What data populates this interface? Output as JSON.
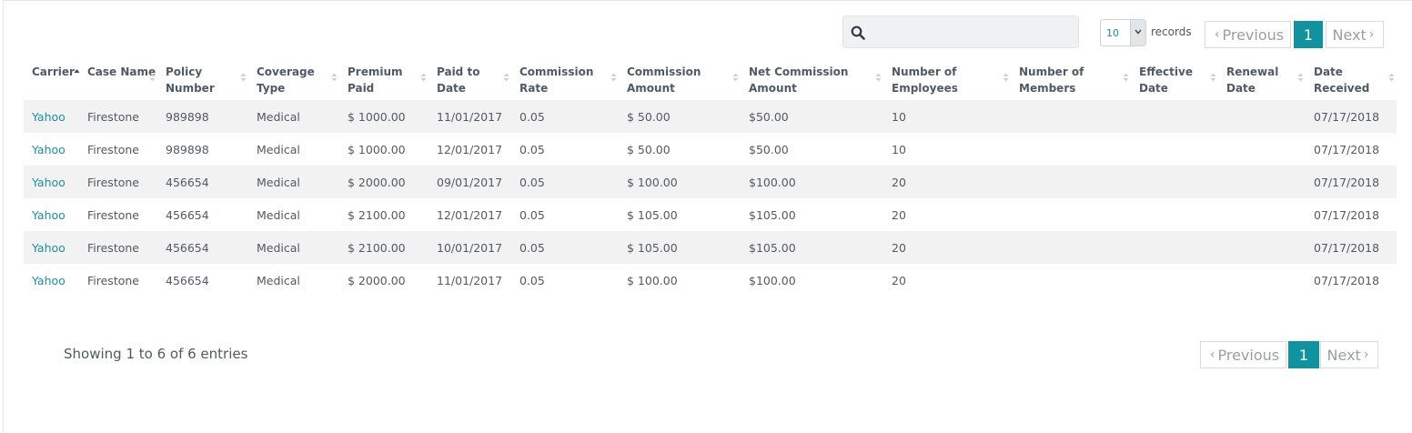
{
  "search": {
    "value": "",
    "placeholder": ""
  },
  "length": {
    "value": "10",
    "label": "records"
  },
  "pagination": {
    "previous": "Previous",
    "current": "1",
    "next": "Next"
  },
  "columns": [
    "Carrier",
    "Case Name",
    "Policy Number",
    "Coverage Type",
    "Premium Paid",
    "Paid to Date",
    "Commission Rate",
    "Commission Amount",
    "Net Commission Amount",
    "Number of Employees",
    "Number of Members",
    "Effective Date",
    "Renewal Date",
    "Date Received"
  ],
  "sorted_column": "Carrier",
  "rows": [
    [
      "Yahoo",
      "Firestone",
      "989898",
      "Medical",
      "$ 1000.00",
      "11/01/2017",
      "0.05",
      "$ 50.00",
      "$50.00",
      "10",
      "",
      "",
      "",
      "07/17/2018"
    ],
    [
      "Yahoo",
      "Firestone",
      "989898",
      "Medical",
      "$ 1000.00",
      "12/01/2017",
      "0.05",
      "$ 50.00",
      "$50.00",
      "10",
      "",
      "",
      "",
      "07/17/2018"
    ],
    [
      "Yahoo",
      "Firestone",
      "456654",
      "Medical",
      "$ 2000.00",
      "09/01/2017",
      "0.05",
      "$ 100.00",
      "$100.00",
      "20",
      "",
      "",
      "",
      "07/17/2018"
    ],
    [
      "Yahoo",
      "Firestone",
      "456654",
      "Medical",
      "$ 2100.00",
      "12/01/2017",
      "0.05",
      "$ 105.00",
      "$105.00",
      "20",
      "",
      "",
      "",
      "07/17/2018"
    ],
    [
      "Yahoo",
      "Firestone",
      "456654",
      "Medical",
      "$ 2100.00",
      "10/01/2017",
      "0.05",
      "$ 105.00",
      "$105.00",
      "20",
      "",
      "",
      "",
      "07/17/2018"
    ],
    [
      "Yahoo",
      "Firestone",
      "456654",
      "Medical",
      "$ 2000.00",
      "11/01/2017",
      "0.05",
      "$ 100.00",
      "$100.00",
      "20",
      "",
      "",
      "",
      "07/17/2018"
    ]
  ],
  "info": "Showing 1 to 6 of 6 entries",
  "colors": {
    "accent": "#11939f",
    "link": "#1f8f9e",
    "stripe": "#f2f2f2"
  }
}
